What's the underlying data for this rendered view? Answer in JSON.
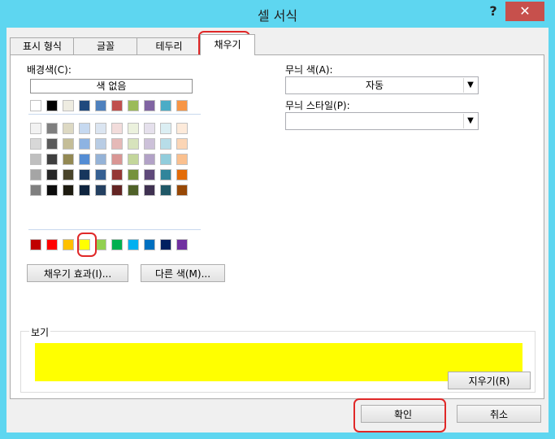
{
  "window": {
    "title": "셀 서식",
    "help": "?",
    "close": "✕"
  },
  "tabs": [
    "표시 형식",
    "글꼴",
    "테두리",
    "채우기"
  ],
  "fill": {
    "bg_label": "배경색(C):",
    "no_color": "색 없음",
    "theme_row": [
      "#ffffff",
      "#000000",
      "#eeece1",
      "#1f497d",
      "#4f81bd",
      "#c0504d",
      "#9bbb59",
      "#8064a2",
      "#4bacc6",
      "#f79646"
    ],
    "shade_rows": [
      [
        "#f2f2f2",
        "#7f7f7f",
        "#ddd9c3",
        "#c6d9f0",
        "#dbe5f1",
        "#f2dcdb",
        "#ebf1dd",
        "#e5e0ec",
        "#dbeef3",
        "#fdeada"
      ],
      [
        "#d8d8d8",
        "#595959",
        "#c4bd97",
        "#8db3e2",
        "#b8cce4",
        "#e5b9b7",
        "#d7e3bc",
        "#ccc1d9",
        "#b7dde8",
        "#fbd5b5"
      ],
      [
        "#bfbfbf",
        "#3f3f3f",
        "#938953",
        "#548dd4",
        "#95b3d7",
        "#d99694",
        "#c3d69b",
        "#b2a2c7",
        "#92cddc",
        "#fac08f"
      ],
      [
        "#a5a5a5",
        "#262626",
        "#494429",
        "#17365d",
        "#366092",
        "#953734",
        "#76923c",
        "#5f497a",
        "#31859b",
        "#e36c09"
      ],
      [
        "#7f7f7f",
        "#0c0c0c",
        "#1d1b10",
        "#0f243e",
        "#244061",
        "#632423",
        "#4f6128",
        "#3f3151",
        "#205867",
        "#974806"
      ]
    ],
    "standard_row": [
      "#c00000",
      "#ff0000",
      "#ffc000",
      "#ffff00",
      "#92d050",
      "#00b050",
      "#00b0f0",
      "#0070c0",
      "#002060",
      "#7030a0"
    ],
    "fill_effects_btn": "채우기 효과(I)...",
    "more_colors_btn": "다른 색(M)...",
    "pattern_color_label": "무늬 색(A):",
    "pattern_color_value": "자동",
    "pattern_style_label": "무늬 스타일(P):",
    "pattern_style_value": "",
    "preview_label": "보기",
    "preview_color": "#ffff00",
    "clear_btn": "지우기(R)"
  },
  "footer": {
    "ok": "확인",
    "cancel": "취소"
  }
}
